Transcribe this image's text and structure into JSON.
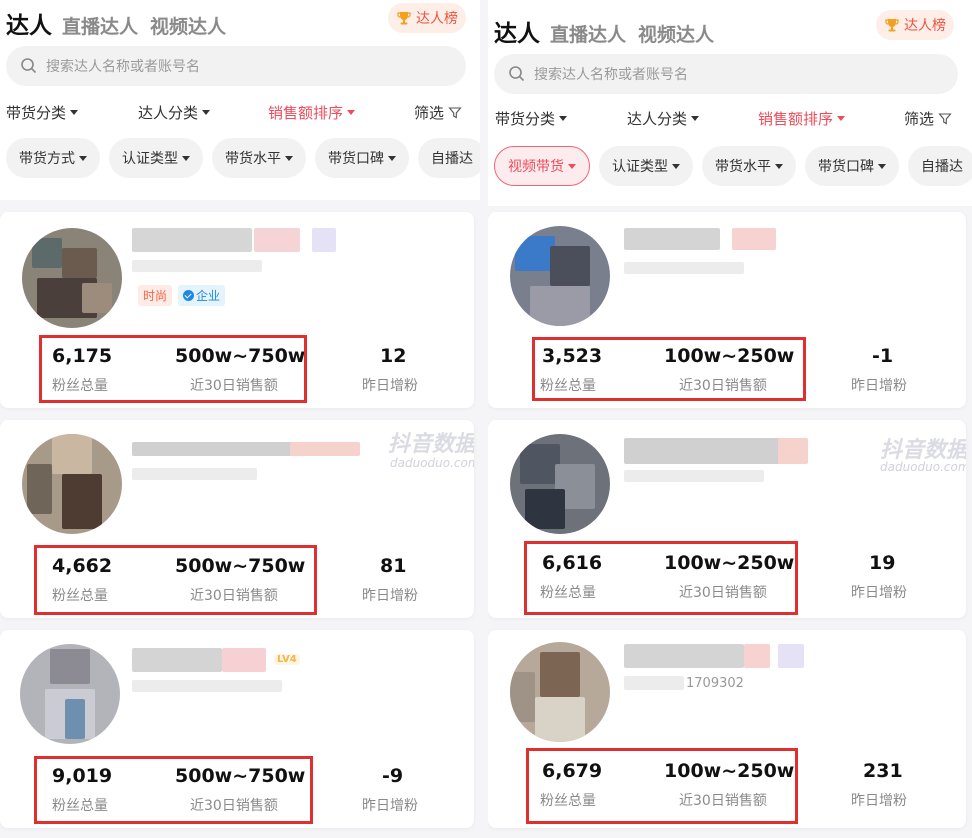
{
  "header": {
    "tab_main": "达人",
    "tab_live": "直播达人",
    "tab_video": "视频达人",
    "rank_label": "达人榜"
  },
  "search": {
    "placeholder": "搜索达人名称或者账号名"
  },
  "filters": {
    "category": "带货分类",
    "creator_type": "达人分类",
    "sort": "销售额排序",
    "screen": "筛选"
  },
  "left_pills": [
    "带货方式",
    "认证类型",
    "带货水平",
    "带货口碑",
    "自播达"
  ],
  "right_pills": [
    "视频带货",
    "认证类型",
    "带货水平",
    "带货口碑",
    "自播达"
  ],
  "labels": {
    "fans_total": "粉丝总量",
    "sales_30d": "近30日销售额",
    "fans_yesterday": "昨日增粉"
  },
  "left_cards": [
    {
      "fans": "6,175",
      "sales": "500w~750w",
      "growth": "12",
      "tags": [
        "时尚",
        "企业"
      ]
    },
    {
      "fans": "4,662",
      "sales": "500w~750w",
      "growth": "81"
    },
    {
      "fans": "9,019",
      "sales": "500w~750w",
      "growth": "-9",
      "level": "LV4"
    }
  ],
  "right_cards": [
    {
      "fans": "3,523",
      "sales": "100w~250w",
      "growth": "-1"
    },
    {
      "fans": "6,616",
      "sales": "100w~250w",
      "growth": "19"
    },
    {
      "fans": "6,679",
      "sales": "100w~250w",
      "growth": "231",
      "account_fragment": "1709302"
    }
  ],
  "watermark": {
    "cn": "抖音数据",
    "en": "daduoduo.com"
  },
  "colors": {
    "accent_red": "#ef4b5a",
    "highlight_box": "#e02f2f",
    "rank_orange": "#f0533f"
  }
}
